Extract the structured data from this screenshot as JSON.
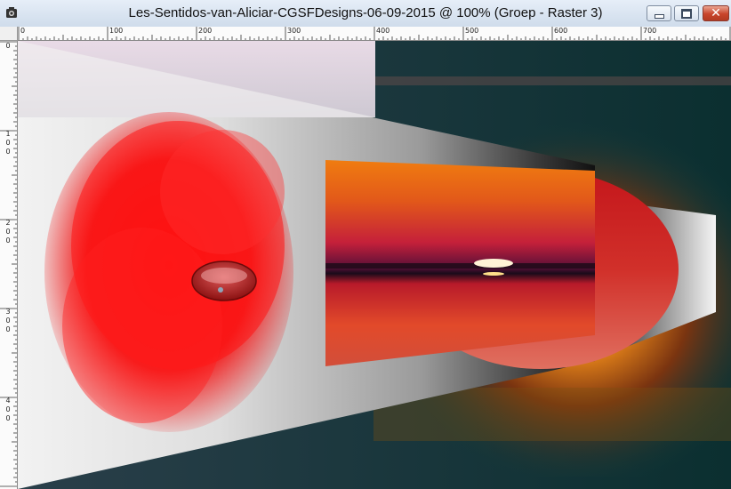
{
  "window": {
    "title": "Les-Sentidos-van-Aliciar-CGSFDesigns-06-09-2015 @ 100% (Groep - Raster 3)",
    "buttons": {
      "minimize_icon": "minimize-icon",
      "maximize_icon": "maximize-icon",
      "close_icon": "close-icon",
      "close_glyph": "✕"
    }
  },
  "rulers": {
    "horizontal_labels": [
      "0",
      "100",
      "200",
      "300",
      "400",
      "500",
      "600",
      "700"
    ],
    "vertical_labels": [
      [
        "0"
      ],
      [
        "1",
        "0",
        "0"
      ],
      [
        "2",
        "0",
        "0"
      ],
      [
        "3",
        "0",
        "0"
      ],
      [
        "4",
        "0",
        "0"
      ]
    ]
  },
  "canvas": {
    "description_icon": "image-canvas",
    "colors": {
      "accent_red": "#ff1a1a",
      "teal": "#0f3b3a",
      "sunset_orange": "#e8841c"
    }
  }
}
